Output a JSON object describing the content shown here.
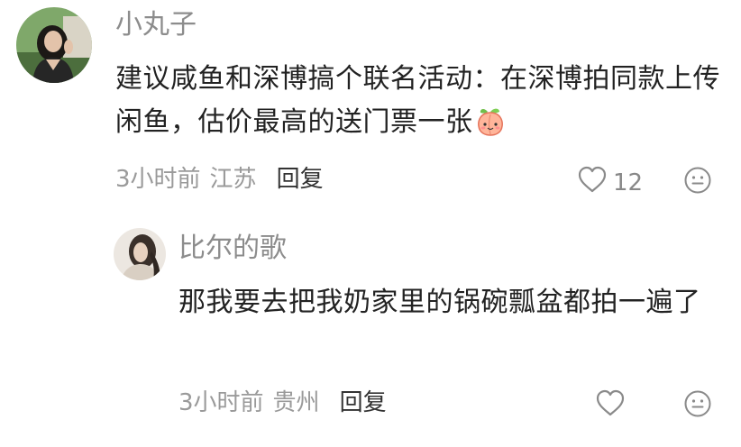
{
  "comments": [
    {
      "username": "小丸子",
      "text": "建议咸鱼和深博搞个联名活动：在深博拍同款上传闲鱼，估价最高的送门票一张",
      "emoji": "peach-emoji",
      "time": "3小时前",
      "location": "江苏",
      "reply_label": "回复",
      "like_count": "12",
      "icons": {
        "like": "heart-icon",
        "react": "smile-face-icon"
      }
    },
    {
      "username": "比尔的歌",
      "text": "那我要去把我奶家里的锅碗瓢盆都拍一遍了",
      "time": "3小时前",
      "location": "贵州",
      "reply_label": "回复",
      "icons": {
        "like": "heart-icon",
        "react": "smile-face-icon"
      }
    }
  ],
  "colors": {
    "username": "#8c8c8c",
    "content": "#222222",
    "meta": "#9a9a9a",
    "reply": "#333333"
  }
}
